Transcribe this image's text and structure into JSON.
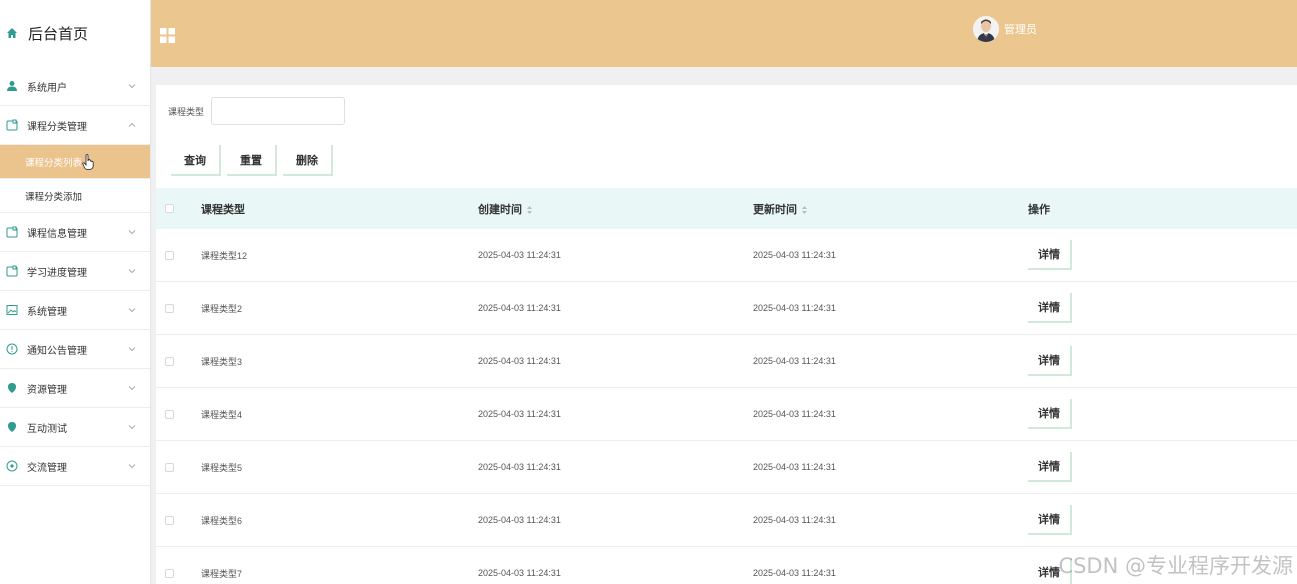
{
  "brand": {
    "title": "后台首页"
  },
  "sidebar": {
    "items": [
      {
        "label": "系统用户",
        "icon": "user-icon"
      },
      {
        "label": "课程分类管理",
        "icon": "folder-icon",
        "expanded": true,
        "children": [
          {
            "label": "课程分类列表",
            "active": true
          },
          {
            "label": "课程分类添加",
            "active": false
          }
        ]
      },
      {
        "label": "课程信息管理",
        "icon": "folder-icon"
      },
      {
        "label": "学习进度管理",
        "icon": "folder-icon"
      },
      {
        "label": "系统管理",
        "icon": "image-icon"
      },
      {
        "label": "通知公告管理",
        "icon": "info-icon"
      },
      {
        "label": "资源管理",
        "icon": "pin-icon"
      },
      {
        "label": "互动测试",
        "icon": "pin-icon"
      },
      {
        "label": "交流管理",
        "icon": "chat-icon"
      }
    ]
  },
  "header": {
    "user_name": "管理员"
  },
  "search": {
    "label": "课程类型",
    "value": "",
    "placeholder": ""
  },
  "buttons": {
    "query": "查询",
    "reset": "重置",
    "delete": "删除"
  },
  "table": {
    "headers": {
      "type": "课程类型",
      "created": "创建时间",
      "updated": "更新时间",
      "action": "操作"
    },
    "rows": [
      {
        "type": "课程类型12",
        "created": "2025-04-03 11:24:31",
        "updated": "2025-04-03 11:24:31",
        "action": "详情"
      },
      {
        "type": "课程类型2",
        "created": "2025-04-03 11:24:31",
        "updated": "2025-04-03 11:24:31",
        "action": "详情"
      },
      {
        "type": "课程类型3",
        "created": "2025-04-03 11:24:31",
        "updated": "2025-04-03 11:24:31",
        "action": "详情"
      },
      {
        "type": "课程类型4",
        "created": "2025-04-03 11:24:31",
        "updated": "2025-04-03 11:24:31",
        "action": "详情"
      },
      {
        "type": "课程类型5",
        "created": "2025-04-03 11:24:31",
        "updated": "2025-04-03 11:24:31",
        "action": "详情"
      },
      {
        "type": "课程类型6",
        "created": "2025-04-03 11:24:31",
        "updated": "2025-04-03 11:24:31",
        "action": "详情"
      },
      {
        "type": "课程类型7",
        "created": "2025-04-03 11:24:31",
        "updated": "2025-04-03 11:24:31",
        "action": "详情"
      }
    ]
  },
  "watermark": "CSDN @专业程序开发源",
  "colors": {
    "header": "#ebc68f",
    "active_menu": "#ebc38c",
    "table_head": "#e9f8f6",
    "icon_accent": "#2e9c8f"
  }
}
